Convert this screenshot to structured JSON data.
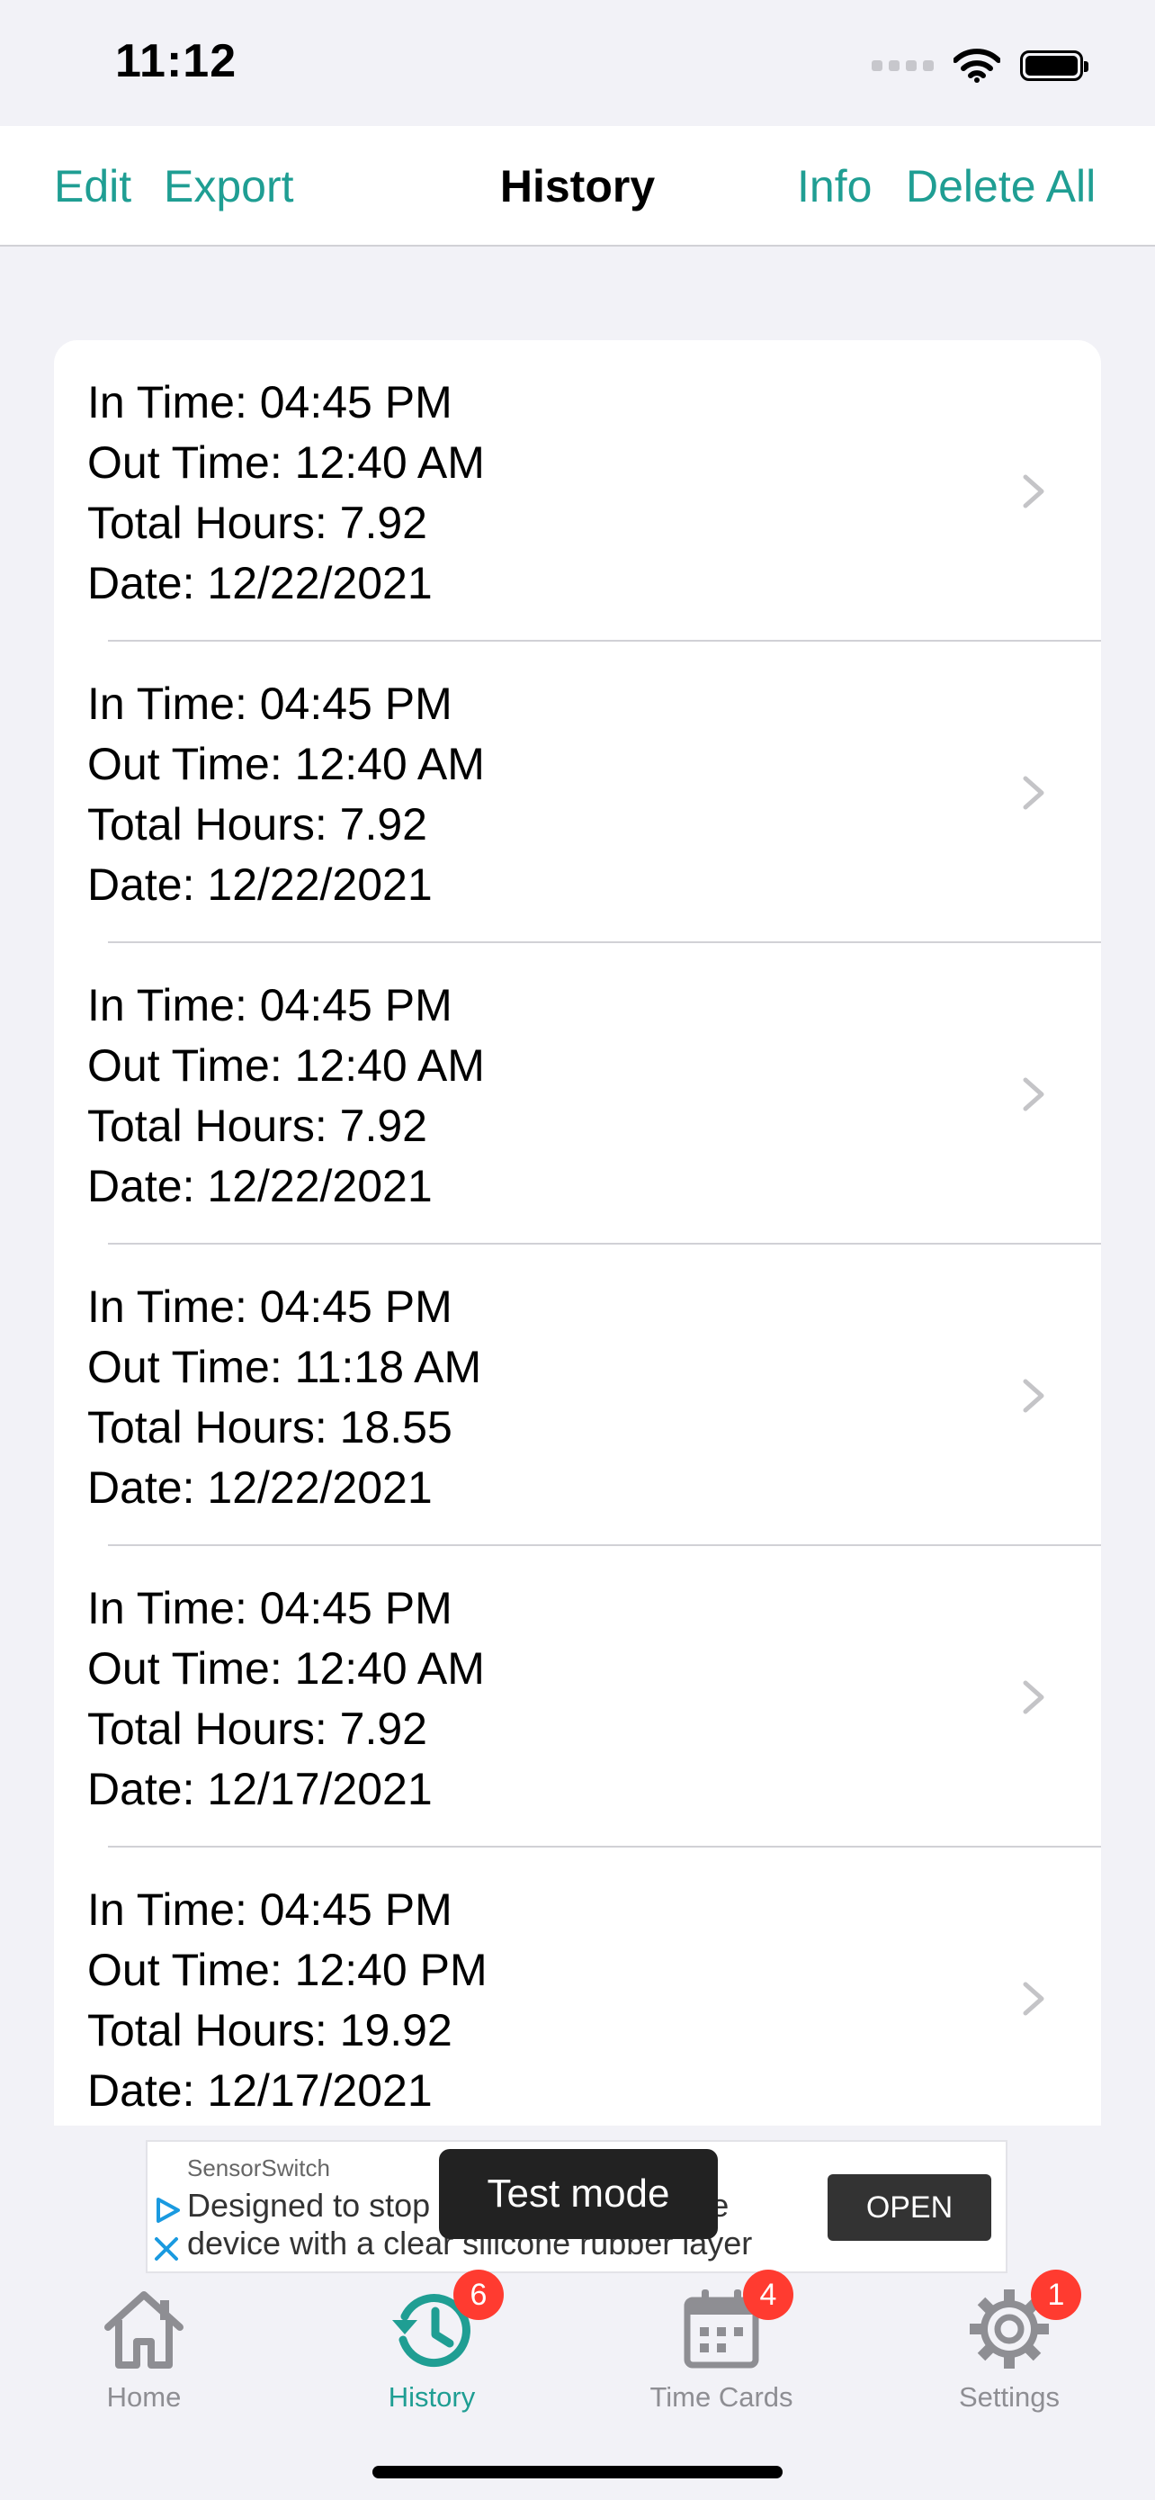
{
  "status_bar": {
    "time": "11:12"
  },
  "nav": {
    "edit": "Edit",
    "export": "Export",
    "title": "History",
    "info": "Info",
    "delete_all": "Delete All"
  },
  "records": [
    {
      "in_time": "In Time: 04:45 PM",
      "out_time": "Out Time: 12:40 AM",
      "total_hours": "Total Hours: 7.92",
      "date": "Date: 12/22/2021"
    },
    {
      "in_time": "In Time: 04:45 PM",
      "out_time": "Out Time: 12:40 AM",
      "total_hours": "Total Hours: 7.92",
      "date": "Date: 12/22/2021"
    },
    {
      "in_time": "In Time: 04:45 PM",
      "out_time": "Out Time: 12:40 AM",
      "total_hours": "Total Hours: 7.92",
      "date": "Date: 12/22/2021"
    },
    {
      "in_time": "In Time: 04:45 PM",
      "out_time": "Out Time: 11:18 AM",
      "total_hours": "Total Hours: 18.55",
      "date": "Date: 12/22/2021"
    },
    {
      "in_time": "In Time: 04:45 PM",
      "out_time": "Out Time: 12:40 AM",
      "total_hours": "Total Hours: 7.92",
      "date": "Date: 12/17/2021"
    },
    {
      "in_time": "In Time: 04:45 PM",
      "out_time": "Out Time: 12:40 PM",
      "total_hours": "Total Hours: 19.92",
      "date": "Date: 12/17/2021"
    }
  ],
  "ad": {
    "brand": "SensorSwitch",
    "line1": "Designed to stop light from exiting the",
    "line2": "device with a clear silicone rubber layer",
    "cta": "OPEN",
    "test_mode": "Test mode"
  },
  "tabs": [
    {
      "label": "Home",
      "icon": "house-icon",
      "badge": ""
    },
    {
      "label": "History",
      "icon": "history-clock-icon",
      "badge": "6"
    },
    {
      "label": "Time Cards",
      "icon": "calendar-icon",
      "badge": "4"
    },
    {
      "label": "Settings",
      "icon": "gear-icon",
      "badge": "1"
    }
  ],
  "colors": {
    "accent": "#1f9e93",
    "badge": "#ff3b30",
    "inactive": "#8e8e93",
    "background": "#f2f2f7"
  }
}
